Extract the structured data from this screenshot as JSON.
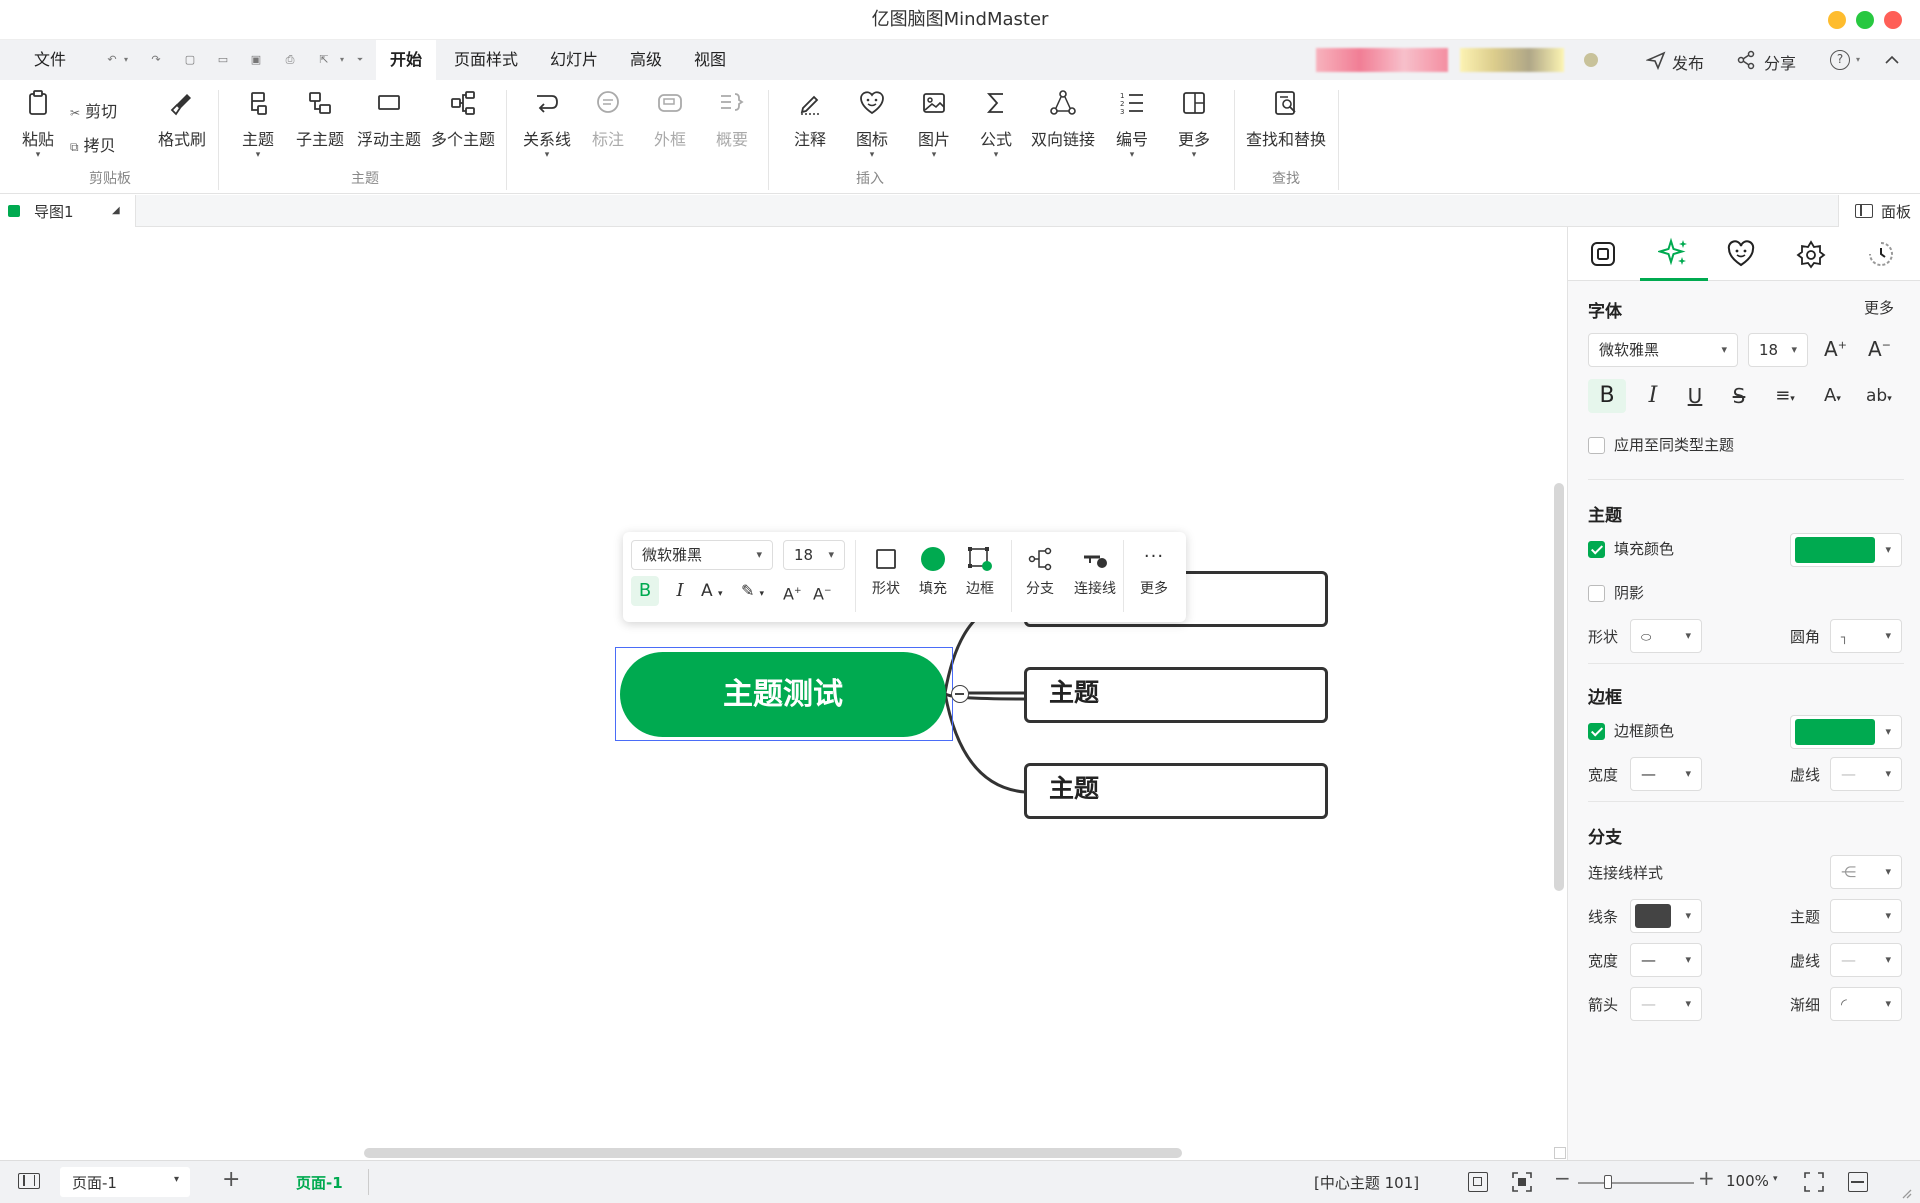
{
  "window": {
    "title": "亿图脑图MindMaster",
    "traffic_lights": {
      "minimize": "#febc2e",
      "maximize": "#28c840",
      "close": "#ff5f57"
    }
  },
  "menu": {
    "file": "文件",
    "tabs": [
      "开始",
      "页面样式",
      "幻灯片",
      "高级",
      "视图"
    ],
    "active_tab": "开始",
    "publish": "发布",
    "share": "分享"
  },
  "ribbon": {
    "paste": "粘贴",
    "cut": "剪切",
    "copy": "拷贝",
    "format_painter": "格式刷",
    "group_clipboard": "剪贴板",
    "topic": "主题",
    "subtopic": "子主题",
    "floating_topic": "浮动主题",
    "multi_topic": "多个主题",
    "group_topic": "主题",
    "relation": "关系线",
    "callout": "标注",
    "boundary": "外框",
    "summary": "概要",
    "note": "注释",
    "icon": "图标",
    "image": "图片",
    "formula": "公式",
    "bilink": "双向链接",
    "numbering": "编号",
    "more": "更多",
    "group_insert": "插入",
    "find_replace": "查找和替换",
    "group_find": "查找"
  },
  "doc_tab": {
    "name": "导图1",
    "panel_toggle": "面板"
  },
  "floatbar": {
    "font": "微软雅黑",
    "size": "18",
    "shape": "形状",
    "fill": "填充",
    "border": "边框",
    "branch": "分支",
    "connector": "连接线",
    "more": "更多"
  },
  "mindmap": {
    "central": "主题测试",
    "central_color": "#00aa50",
    "subtopics": [
      "",
      "主题",
      "主题"
    ]
  },
  "panel": {
    "font_section": "字体",
    "font_more": "更多",
    "font_family": "微软雅黑",
    "font_size": "18",
    "apply_same": "应用至同类型主题",
    "topic_section": "主题",
    "fill_color": "填充颜色",
    "shadow": "阴影",
    "shape": "形状",
    "corner": "圆角",
    "border_section": "边框",
    "border_color": "边框颜色",
    "width": "宽度",
    "dash": "虚线",
    "branch_section": "分支",
    "connector_style": "连接线样式",
    "line": "线条",
    "topic_label": "主题",
    "width2": "宽度",
    "dash2": "虚线",
    "arrow": "箭头",
    "taper": "渐细",
    "accent": "#00aa50",
    "line_color": "#444444"
  },
  "status": {
    "page_selector": "页面-1",
    "page_tab": "页面-1",
    "selection_info": "[中心主题 101]",
    "zoom": "100%"
  }
}
